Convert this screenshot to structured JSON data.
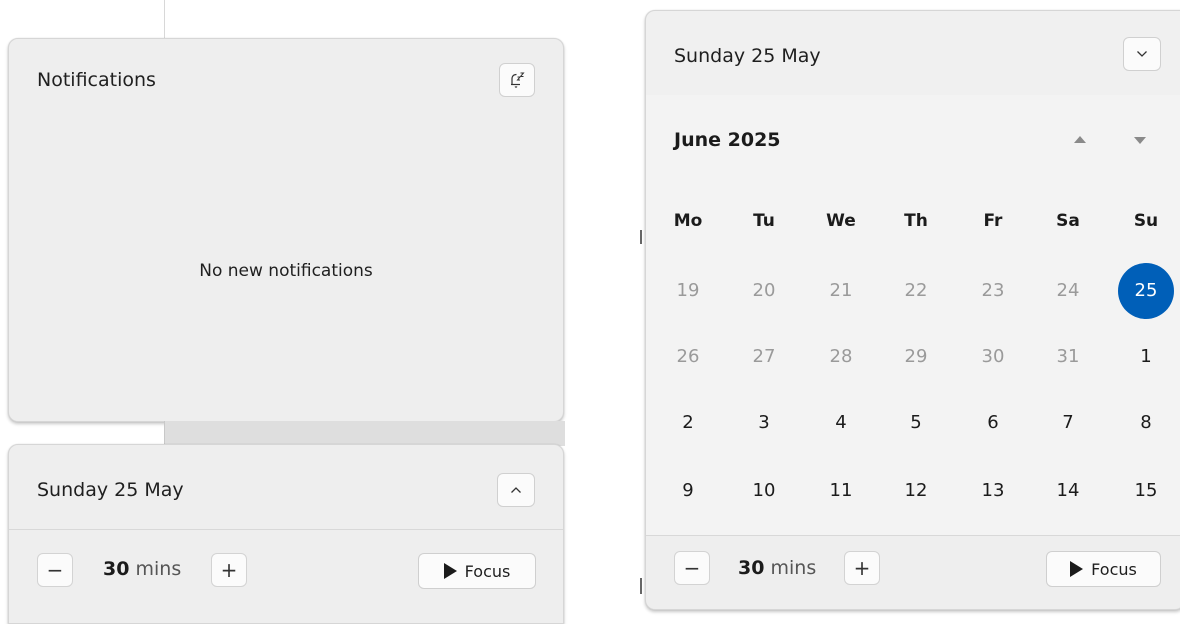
{
  "notifications": {
    "title": "Notifications",
    "empty_message": "No new notifications",
    "snooze_icon": "bell-snooze-icon"
  },
  "left_calendar": {
    "date_label": "Sunday 25 May",
    "toggle_icon": "chevron-up-icon"
  },
  "right_calendar": {
    "date_label": "Sunday 25 May",
    "toggle_icon": "chevron-down-icon",
    "month_label": "June 2025",
    "weekdays": [
      "Mo",
      "Tu",
      "We",
      "Th",
      "Fr",
      "Sa",
      "Su"
    ],
    "weeks": [
      [
        "19",
        "20",
        "21",
        "22",
        "23",
        "24",
        "25"
      ],
      [
        "26",
        "27",
        "28",
        "29",
        "30",
        "31",
        "1"
      ],
      [
        "2",
        "3",
        "4",
        "5",
        "6",
        "7",
        "8"
      ],
      [
        "9",
        "10",
        "11",
        "12",
        "13",
        "14",
        "15"
      ]
    ],
    "today": "25",
    "accent_color": "#005fb8"
  },
  "focus": {
    "minus": "−",
    "value": "30",
    "unit": "mins",
    "plus": "+",
    "button_label": "Focus"
  }
}
